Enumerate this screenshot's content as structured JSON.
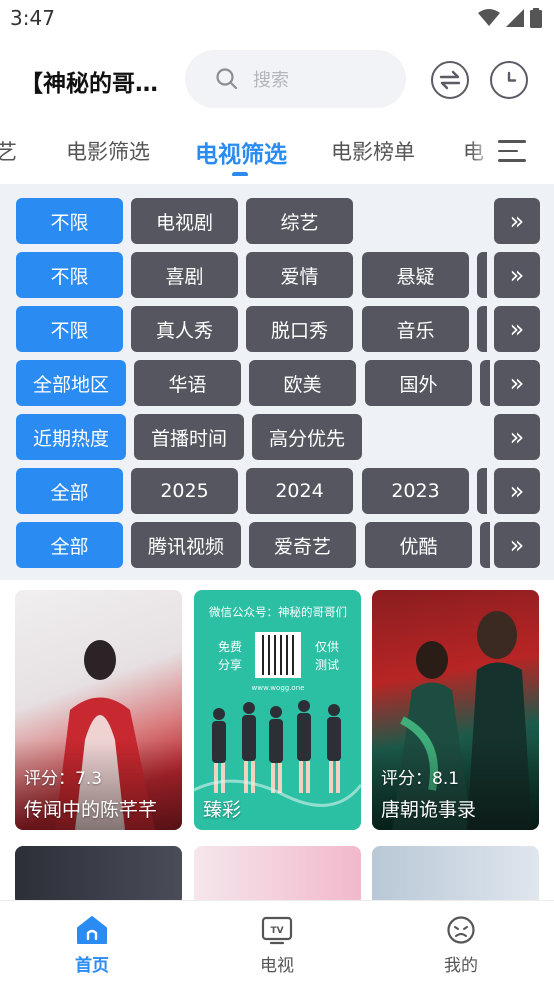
{
  "status_bar": {
    "time": "3:47"
  },
  "header": {
    "title": "【神秘的哥…",
    "search_placeholder": "搜索"
  },
  "tabs": [
    {
      "label": "艺"
    },
    {
      "label": "电影筛选"
    },
    {
      "label": "电视筛选",
      "active": true
    },
    {
      "label": "电影榜单"
    },
    {
      "label": "电"
    }
  ],
  "filters": [
    {
      "options": [
        "不限",
        "电视剧",
        "综艺"
      ],
      "more": "»"
    },
    {
      "options": [
        "不限",
        "喜剧",
        "爱情",
        "悬疑"
      ],
      "more": "»"
    },
    {
      "options": [
        "不限",
        "真人秀",
        "脱口秀",
        "音乐"
      ],
      "more": "»"
    },
    {
      "options": [
        "全部地区",
        "华语",
        "欧美",
        "国外"
      ],
      "more": "»"
    },
    {
      "options": [
        "近期热度",
        "首播时间",
        "高分优先"
      ],
      "more": "»"
    },
    {
      "options": [
        "全部",
        "2025",
        "2024",
        "2023"
      ],
      "more": "»"
    },
    {
      "options": [
        "全部",
        "腾讯视频",
        "爱奇艺",
        "优酷"
      ],
      "more": "»"
    }
  ],
  "cards": [
    {
      "title": "传闻中的陈芊芊",
      "rating": "评分：7.3"
    },
    {
      "title": "臻彩",
      "rating": "",
      "poster_text": {
        "heading": "微信公众号：神秘的哥哥们",
        "left": "免费\n分享",
        "right": "仅供\n测试",
        "url": "www.wogg.one"
      }
    },
    {
      "title": "唐朝诡事录",
      "rating": "评分：8.1"
    }
  ],
  "bottom_nav": [
    {
      "label": "首页",
      "icon": "home-icon",
      "active": true
    },
    {
      "label": "电视",
      "icon": "tv-icon"
    },
    {
      "label": "我的",
      "icon": "face-icon"
    }
  ],
  "colors": {
    "accent": "#2a8bf2",
    "chip": "#55565f",
    "panel": "#eef2f7"
  }
}
